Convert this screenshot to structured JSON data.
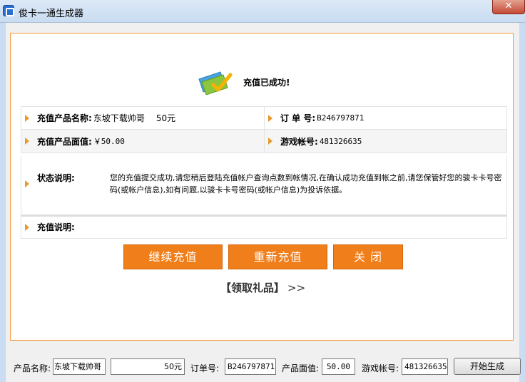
{
  "window": {
    "title": "俊卡一通生成器",
    "close_symbol": "✕"
  },
  "result": {
    "success_text": "充值已成功!",
    "product_name_label": "充值产品名称:",
    "product_name_value": "东坡下载帅哥",
    "product_name_amount": "50元",
    "order_label": "订 单 号:",
    "order_value": "B246797871",
    "face_value_label": "充值产品面值:",
    "face_value_value": "￥50.00",
    "game_account_label": "游戏帐号:",
    "game_account_value": "481326635",
    "status_label": "状态说明:",
    "status_text": "您的充值提交成功,请您稍后登陆充值帐户查询点数到帐情况,在确认成功充值到帐之前,请您保管好您的骏卡卡号密码(或帐户信息),如有问题,以骏卡卡号密码(或帐户信息)为投诉依据。",
    "recharge_note_label": "充值说明:"
  },
  "buttons": {
    "continue": "继续充值",
    "redo": "重新充值",
    "close": "关 闭"
  },
  "gift": {
    "label": "【领取礼品】",
    "arrows": ">>"
  },
  "form": {
    "product_name_label": "产品名称:",
    "product_name_value": "东坡下载帅哥",
    "amount_value": "50元",
    "order_label": "订单号:",
    "order_value": "B246797871",
    "face_label": "产品面值:",
    "face_value": "50.00",
    "account_label": "游戏帐号:",
    "account_value": "481326635",
    "generate_button": "开始生成"
  },
  "colors": {
    "accent_orange": "#f07e1a",
    "panel_border": "#f59a3c",
    "triangle": "#e99a2b"
  }
}
